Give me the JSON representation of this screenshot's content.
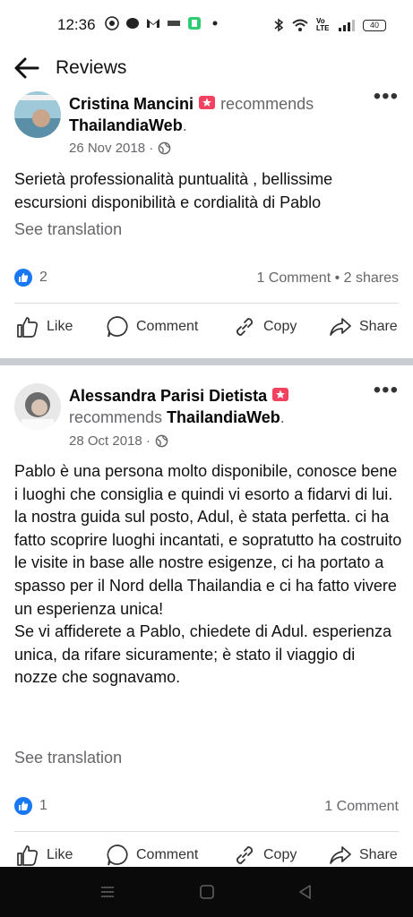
{
  "status": {
    "time": "12:36",
    "battery": "40",
    "volte": "Vo LTE"
  },
  "header": {
    "title": "Reviews"
  },
  "posts": [
    {
      "author": "Cristina Mancini",
      "verb": "recommends",
      "page": "ThailandiaWeb",
      "date": "26 Nov 2018 ·",
      "body": "Serietà professionalità puntualità , bellissime escursioni  disponibilità e cordialità di Pablo",
      "see_translation": "See translation",
      "likes": "2",
      "stats_right": "1 Comment • 2 shares"
    },
    {
      "author": "Alessandra Parisi Dietista",
      "verb": "recommends",
      "page": "ThailandiaWeb",
      "date": "28 Oct 2018 ·",
      "body": "Pablo è una persona molto disponibile, conosce bene i luoghi che consiglia e quindi vi esorto a fidarvi di lui.\nla nostra guida sul posto, Adul, è stata perfetta. ci ha fatto scoprire luoghi incantati, e sopratutto ha costruito le visite in base alle nostre esigenze, ci ha portato a spasso per il Nord della Thailandia e ci ha fatto vivere un esperienza unica!\nSe vi affiderete a Pablo, chiedete di Adul. esperienza unica, da rifare sicuramente; è stato il viaggio di nozze che sognavamo.",
      "see_translation": "See translation",
      "likes": "1",
      "stats_right": "1 Comment"
    }
  ],
  "actions": {
    "like": "Like",
    "comment": "Comment",
    "copy": "Copy",
    "share": "Share"
  },
  "colors": {
    "accent": "#1877f2",
    "recommend_badge": "#f3425f",
    "muted": "#65676b"
  }
}
